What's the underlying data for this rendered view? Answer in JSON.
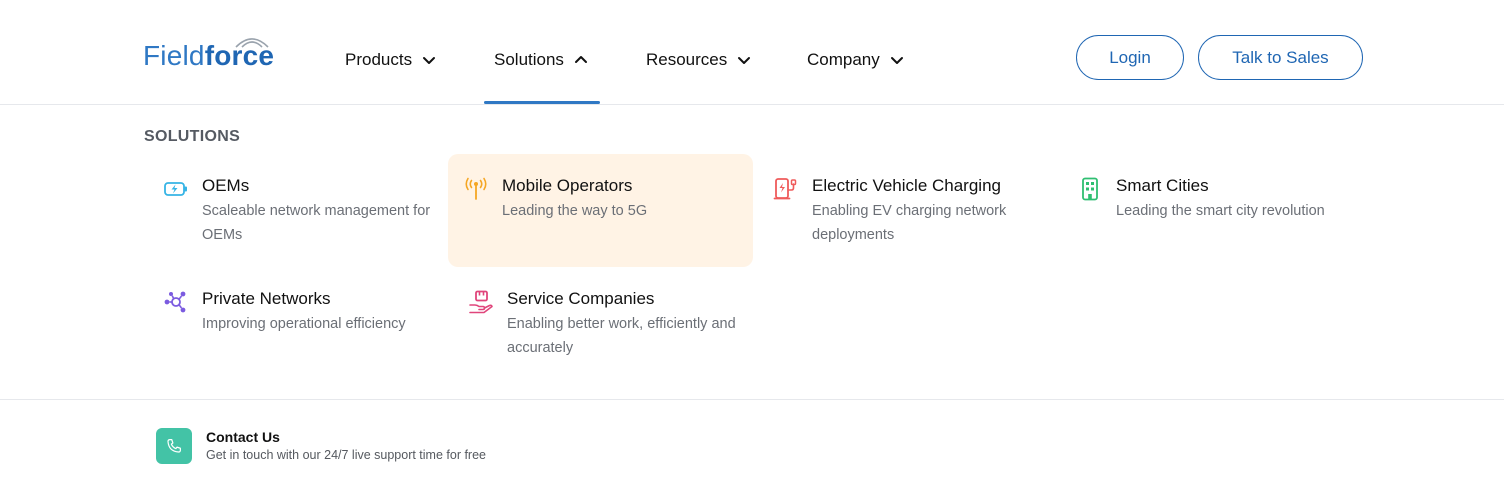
{
  "logo": {
    "part1": "Field",
    "part2": "force"
  },
  "nav": {
    "items": [
      {
        "label": "Products",
        "expanded": false
      },
      {
        "label": "Solutions",
        "expanded": true
      },
      {
        "label": "Resources",
        "expanded": false
      },
      {
        "label": "Company",
        "expanded": false
      }
    ]
  },
  "header_buttons": {
    "login": "Login",
    "sales": "Talk to Sales"
  },
  "menu": {
    "heading": "SOLUTIONS",
    "items": [
      {
        "title": "OEMs",
        "description": "Scaleable network management for OEMs",
        "icon": "battery-charging-icon",
        "color": "#36b4e5"
      },
      {
        "title": "Mobile Operators",
        "description": "Leading the way to 5G",
        "icon": "antenna-icon",
        "color": "#f5a623"
      },
      {
        "title": "Electric Vehicle Charging",
        "description": "Enabling EV charging network deployments",
        "icon": "ev-charger-icon",
        "color": "#ef5b5b"
      },
      {
        "title": "Smart Cities",
        "description": "Leading the smart city revolution",
        "icon": "building-icon",
        "color": "#2fbf71"
      },
      {
        "title": "Private Networks",
        "description": "Improving operational efficiency",
        "icon": "network-nodes-icon",
        "color": "#7b5be0"
      },
      {
        "title": "Service Companies",
        "description": "Enabling better work, efficiently and accurately",
        "icon": "service-hand-icon",
        "color": "#e0457b"
      }
    ]
  },
  "contact": {
    "title": "Contact Us",
    "description": "Get in touch with our 24/7 live support time for free",
    "icon": "phone-icon",
    "color": "#43c3a6"
  },
  "colors": {
    "brand": "#1f66b3",
    "highlight": "#fff3e5"
  }
}
